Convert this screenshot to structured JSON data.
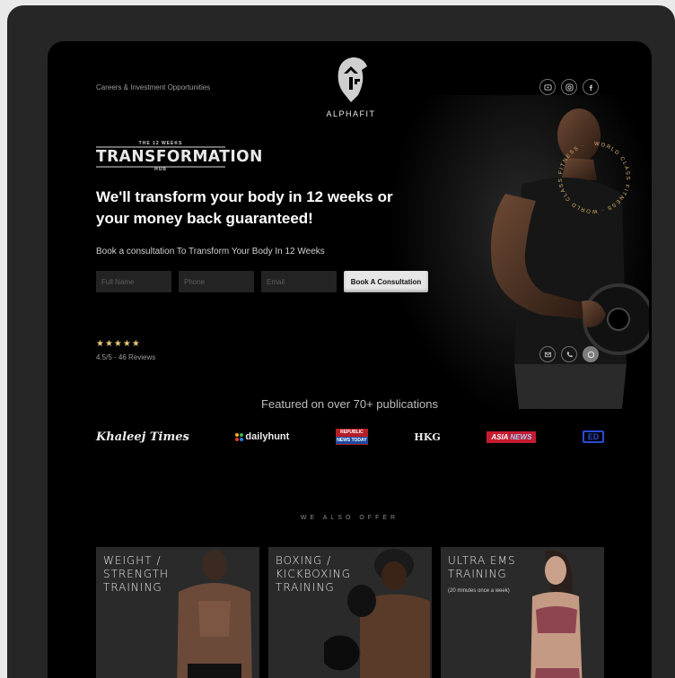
{
  "header": {
    "careers_link": "Careers & Investment Opportunities",
    "brand": "ALPHAFIT",
    "social_icons": [
      "youtube-icon",
      "instagram-icon",
      "facebook-icon"
    ]
  },
  "hero": {
    "badge_top": "THE 12 WEEKS",
    "badge_main": "TRANSFORMATION",
    "badge_bottom": "HUB",
    "headline": "We'll transform your body in 12 weeks or your money back guaranteed!",
    "subtext": "Book a consultation To Transform Your Body In 12  Weeks",
    "ring_text": "WORLD CLASS FITNESS · WORLD CLASS FITNESS ·"
  },
  "form": {
    "name_placeholder": "Full Name",
    "phone_placeholder": "Phone",
    "email_placeholder": "Email",
    "cta_label": "Book A Consultation"
  },
  "reviews": {
    "stars": "★★★★★",
    "summary": "4.5/5 - 46 Reviews"
  },
  "contact_icons": [
    "mail-icon",
    "phone-icon",
    "whatsapp-icon"
  ],
  "featured": {
    "title": "Featured on over 70+ publications",
    "publications": {
      "khaleej": "Khaleej Times",
      "dailyhunt": "dailyhunt",
      "republic_top": "REPUBLIC",
      "republic_bottom": "NEWS TODAY",
      "hkg": "HKG",
      "asia_a": "ASIA",
      "asia_b": "NEWS",
      "ed": "ED"
    }
  },
  "offer": {
    "heading": "WE ALSO OFFER",
    "cards": [
      {
        "title": "WEIGHT /\nSTRENGTH\nTRAINING",
        "note": ""
      },
      {
        "title": "BOXING /\nKICKBOXING\nTRAINING",
        "note": ""
      },
      {
        "title": "ULTRA EMS\nTRAINING",
        "note": "(20 minutes once a week)"
      }
    ]
  },
  "colors": {
    "background": "#000000",
    "star": "#e8c879",
    "ring_text": "#d9b36a",
    "card": "#2a2a2a"
  }
}
